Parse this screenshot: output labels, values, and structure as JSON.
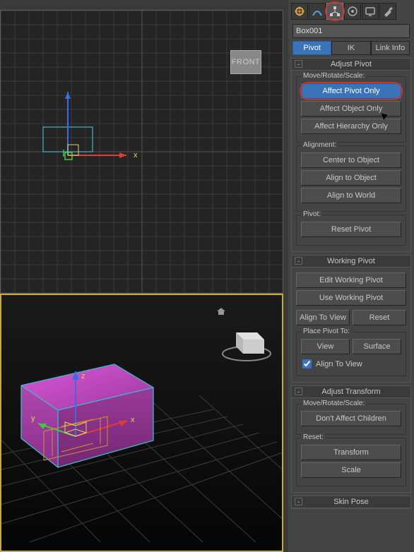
{
  "object_name": "Box001",
  "tabs": {
    "pivot": "Pivot",
    "ik": "IK",
    "link_info": "Link Info"
  },
  "adjust_pivot": {
    "title": "Adjust Pivot",
    "mrs_label": "Move/Rotate/Scale:",
    "affect_pivot": "Affect Pivot Only",
    "affect_object": "Affect Object Only",
    "affect_hierarchy": "Affect Hierarchy Only",
    "alignment_label": "Alignment:",
    "center_to_object": "Center to Object",
    "align_to_object": "Align to Object",
    "align_to_world": "Align to World",
    "pivot_label": "Pivot:",
    "reset_pivot": "Reset Pivot"
  },
  "working_pivot": {
    "title": "Working Pivot",
    "edit": "Edit Working Pivot",
    "use": "Use Working Pivot",
    "align_to_view": "Align To View",
    "reset": "Reset",
    "place_label": "Place Pivot To:",
    "view": "View",
    "surface": "Surface",
    "align_check": "Align To View"
  },
  "adjust_transform": {
    "title": "Adjust Transform",
    "mrs_label": "Move/Rotate/Scale:",
    "dont_affect": "Don't Affect Children",
    "reset_label": "Reset:",
    "transform": "Transform",
    "scale": "Scale"
  },
  "skin_pose": {
    "title": "Skin Pose"
  },
  "top_icons": {
    "create": "create-icon",
    "modify": "modify-icon",
    "hierarchy": "hierarchy-icon",
    "motion": "motion-icon",
    "display": "display-icon",
    "utilities": "utilities-icon"
  },
  "axes": {
    "x": "x",
    "y": "y",
    "z": "z"
  },
  "viewcube_label": "FRONT"
}
